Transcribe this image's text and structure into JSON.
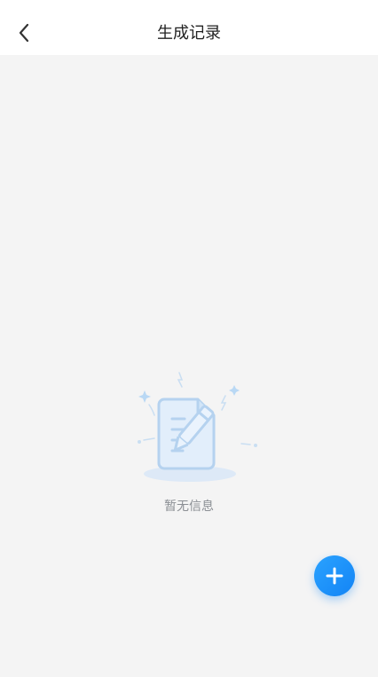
{
  "header": {
    "title": "生成记录",
    "back_icon": "chevron-left-icon"
  },
  "empty_state": {
    "message": "暂无信息",
    "illustration_icon": "document-edit-icon"
  },
  "fab": {
    "icon": "plus-icon",
    "color": "#1b8ff8"
  }
}
